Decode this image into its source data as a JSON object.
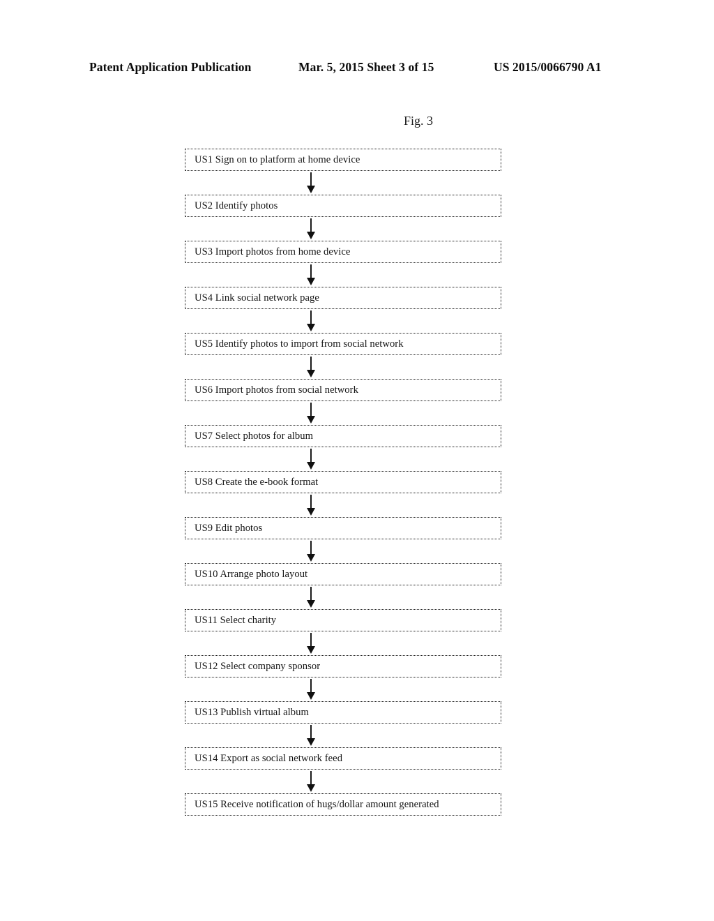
{
  "header": {
    "publication": "Patent Application Publication",
    "date_sheet": "Mar. 5, 2015   Sheet 3 of 15",
    "patent_number": "US 2015/0066790 A1"
  },
  "figure": {
    "label": "Fig. 3"
  },
  "flowchart": {
    "steps": [
      {
        "id": "US1",
        "label": "US1  Sign on to platform at home device"
      },
      {
        "id": "US2",
        "label": "US2  Identify photos"
      },
      {
        "id": "US3",
        "label": "US3  Import photos from home device"
      },
      {
        "id": "US4",
        "label": "US4  Link social network page"
      },
      {
        "id": "US5",
        "label": "US5  Identify photos to import from social network"
      },
      {
        "id": "US6",
        "label": "US6  Import photos from social network"
      },
      {
        "id": "US7",
        "label": "US7  Select photos for album"
      },
      {
        "id": "US8",
        "label": "US8  Create the e-book format"
      },
      {
        "id": "US9",
        "label": "US9  Edit photos"
      },
      {
        "id": "US10",
        "label": "US10  Arrange photo layout"
      },
      {
        "id": "US11",
        "label": "US11  Select charity"
      },
      {
        "id": "US12",
        "label": "US12  Select company sponsor"
      },
      {
        "id": "US13",
        "label": "US13  Publish virtual album"
      },
      {
        "id": "US14",
        "label": "US14  Export as social network feed"
      },
      {
        "id": "US15",
        "label": "US15  Receive notification of hugs/dollar amount generated"
      }
    ]
  }
}
